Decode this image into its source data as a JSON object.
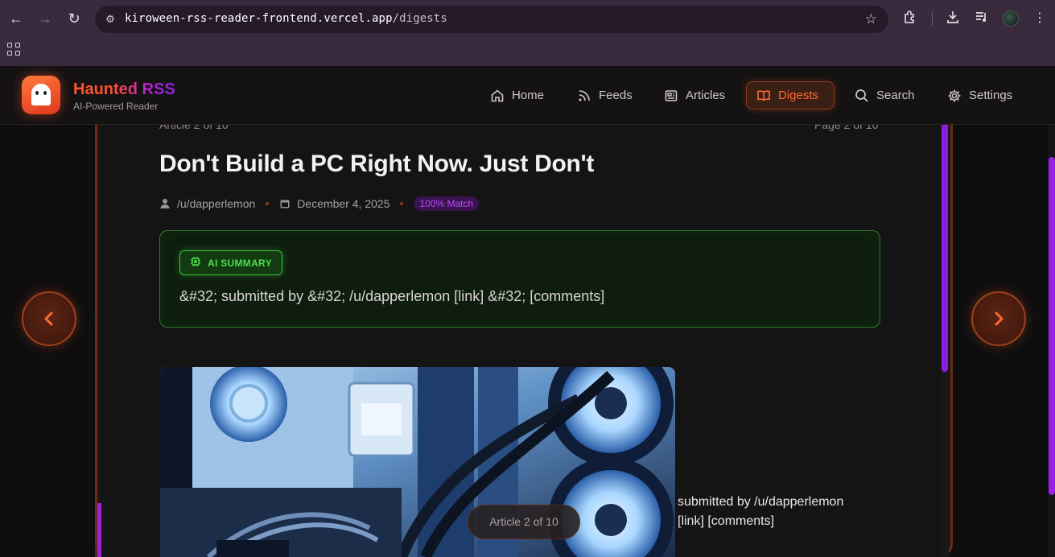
{
  "browser": {
    "url_host": "kiroween-rss-reader-frontend.vercel.app",
    "url_path": "/digests"
  },
  "app": {
    "brand_title": "Haunted RSS",
    "brand_subtitle": "AI-Powered Reader",
    "nav": [
      {
        "label": "Home",
        "icon": "home-icon"
      },
      {
        "label": "Feeds",
        "icon": "rss-icon"
      },
      {
        "label": "Articles",
        "icon": "newspaper-icon"
      },
      {
        "label": "Digests",
        "icon": "book-open-icon",
        "active": true
      },
      {
        "label": "Search",
        "icon": "search-icon"
      },
      {
        "label": "Settings",
        "icon": "gear-icon"
      }
    ]
  },
  "article": {
    "position_top": "Article 2 of 10",
    "page_top": "Page 2 of 10",
    "title": "Don't Build a PC Right Now. Just Don't",
    "author": "/u/dapperlemon",
    "date": "December 4, 2025",
    "match": "100% Match",
    "ai_label": "AI SUMMARY",
    "summary": "&#32; submitted by &#32; /u/dapperlemon [link] &#32; [comments]",
    "caption_line1": "submitted by /u/dapperlemon",
    "caption_line2": "[link] [comments]",
    "pill": "Article 2 of 10"
  },
  "colors": {
    "accent": "#ff6a2e",
    "purple": "#8a1ee0",
    "ai_green": "#4be04a"
  }
}
